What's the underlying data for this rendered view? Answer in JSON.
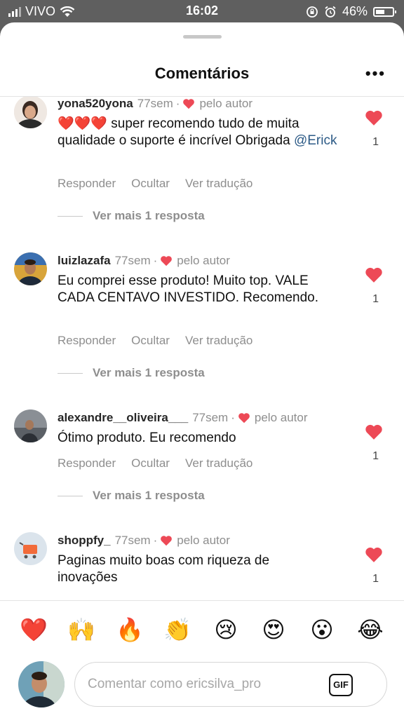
{
  "status_bar": {
    "carrier": "VIVO",
    "time": "16:02",
    "battery": "46%"
  },
  "sheet": {
    "title": "Comentários",
    "more": "•••"
  },
  "comments": [
    {
      "username": "yona520yona",
      "time": "77sem",
      "author_badge": "pelo autor",
      "text_parts": [
        "❤️❤️❤️ super recomendo  tudo de muita qualidade  o suporte é  incrível Obrigada ",
        "@Erick"
      ],
      "likes": "1",
      "actions": [
        "Responder",
        "Ocultar",
        "Ver tradução"
      ],
      "more_replies": "Ver mais 1 resposta"
    },
    {
      "username": "luizlazafa",
      "time": "77sem",
      "author_badge": "pelo autor",
      "text": "Eu comprei esse produto! Muito top. VALE CADA CENTAVO INVESTIDO. Recomendo.",
      "likes": "1",
      "actions": [
        "Responder",
        "Ocultar",
        "Ver tradução"
      ],
      "more_replies": "Ver mais 1 resposta"
    },
    {
      "username": "alexandre__oliveira___",
      "time": "77sem",
      "author_badge": "pelo autor",
      "text": "Ótimo produto. Eu recomendo",
      "likes": "1",
      "actions": [
        "Responder",
        "Ocultar",
        "Ver tradução"
      ],
      "more_replies": "Ver mais 1 resposta"
    },
    {
      "username": "shoppfy_",
      "time": "77sem",
      "author_badge": "pelo autor",
      "text": "Paginas muito boas com riqueza de inovações",
      "likes": "1"
    }
  ],
  "emoji_bar": [
    "❤️",
    "🙌",
    "🔥",
    "👏",
    "😢",
    "😍",
    "😮",
    "😂"
  ],
  "composer": {
    "placeholder": "Comentar como ericsilva_pro",
    "gif_label": "GIF"
  },
  "colors": {
    "like_red": "#ed4956",
    "mention_blue": "#2c5a86",
    "muted_text": "#8e8e8e"
  }
}
